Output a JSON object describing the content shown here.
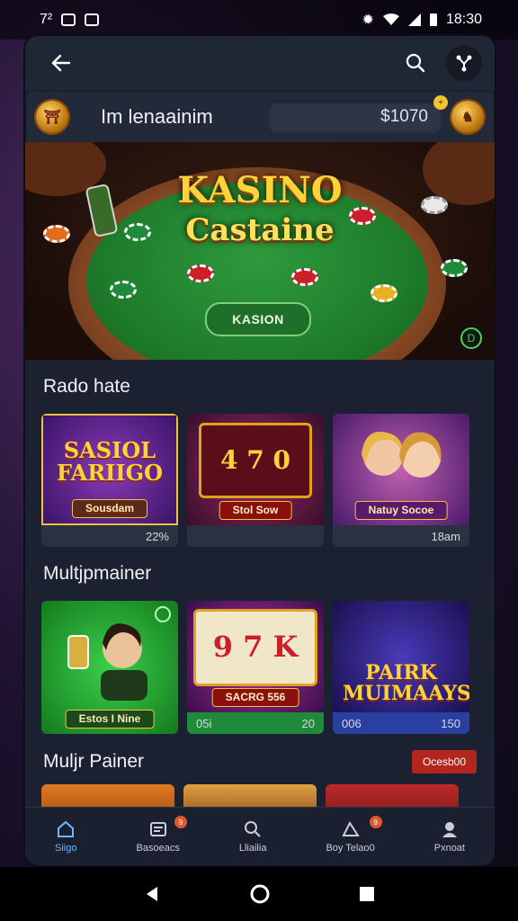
{
  "status_bar": {
    "left_text": "7²",
    "time": "18:30"
  },
  "header": {
    "title": "Im lenaainim",
    "balance": "$1070"
  },
  "hero": {
    "title_line1": "KASINO",
    "title_line2": "Castaine",
    "button_label": "KASION",
    "badge": "D"
  },
  "sections": [
    {
      "title": "Rado hate",
      "cards": [
        {
          "art_text": "SASIOL FARIIGO",
          "label": "Sousdam",
          "footer": "22%"
        },
        {
          "art_text": "4 7 0",
          "label": "Stol Sow",
          "footer": ""
        },
        {
          "art_text": "",
          "label": "Natuy Socoe",
          "footer": "18am"
        }
      ]
    },
    {
      "title": "Multjpmainer",
      "cards": [
        {
          "art_text": "",
          "label": "Estos I Nine",
          "footer_left": "",
          "footer_right": ""
        },
        {
          "art_text": "9 7 K",
          "label": "SACRG 556",
          "footer_left": "05i",
          "footer_right": "20"
        },
        {
          "art_text": "PAIRK MUIMAAYS",
          "label": "",
          "footer_left": "006",
          "footer_right": "150"
        }
      ]
    }
  ],
  "section3": {
    "title": "Muljr Painer",
    "pill": "Ocesb00"
  },
  "bottom_nav": [
    {
      "label": "Siigo",
      "icon": "home-icon",
      "active": true
    },
    {
      "label": "Basoeacs",
      "icon": "list-icon",
      "badge": "9"
    },
    {
      "label": "Lliailia",
      "icon": "search-icon"
    },
    {
      "label": "Boy Telao0",
      "icon": "cards-icon",
      "badge": "9"
    },
    {
      "label": "Pxnoat",
      "icon": "profile-icon"
    }
  ],
  "colors": {
    "accent": "#6fb6ff",
    "gold": "#ffd23a",
    "felt": "#1d7a2a",
    "alert": "#b3261e"
  }
}
